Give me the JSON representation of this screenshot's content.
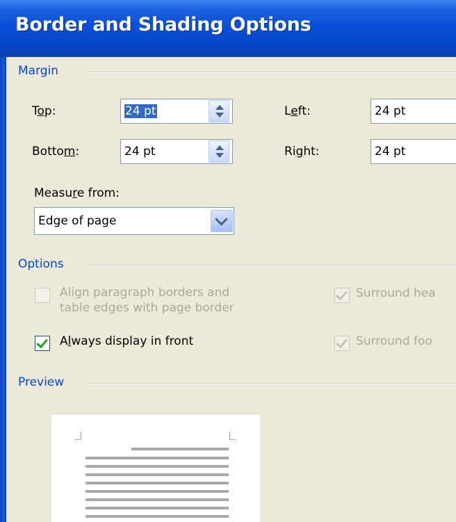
{
  "dialog": {
    "title": "Border and Shading Options"
  },
  "margin": {
    "group_label": "Margin",
    "top": {
      "label_pre": "T",
      "label_ul": "o",
      "label_post": "p:",
      "value": "24 pt"
    },
    "bottom": {
      "label_pre": "Botto",
      "label_ul": "m",
      "label_post": ":",
      "value": "24 pt"
    },
    "left": {
      "label_pre": "L",
      "label_ul": "e",
      "label_post": "ft:",
      "value": "24 pt"
    },
    "right": {
      "label_pre": "Ri",
      "label_ul": "g",
      "label_post": "ht:",
      "value": "24 pt"
    },
    "measure_from": {
      "label_pre": "Measu",
      "label_ul": "r",
      "label_post": "e from:",
      "value": "Edge of page"
    }
  },
  "options": {
    "group_label": "Options",
    "align_paragraph": {
      "line1": "Align paragraph borders and",
      "line2": "table edges with page border",
      "checked": false,
      "enabled": false
    },
    "always_front": {
      "label_pre": "A",
      "label_ul": "l",
      "label_post": "ways display in front",
      "checked": true,
      "enabled": true
    },
    "surround_header": {
      "label": "Surround hea",
      "checked": true,
      "enabled": false
    },
    "surround_footer": {
      "label": "Surround foo",
      "checked": true,
      "enabled": false
    }
  },
  "preview": {
    "group_label": "Preview"
  },
  "colors": {
    "accent": "#0046d5",
    "title_bar": "#0a4fd9",
    "dialog_bg": "#ece9d8",
    "disabled_text": "#aca899"
  }
}
